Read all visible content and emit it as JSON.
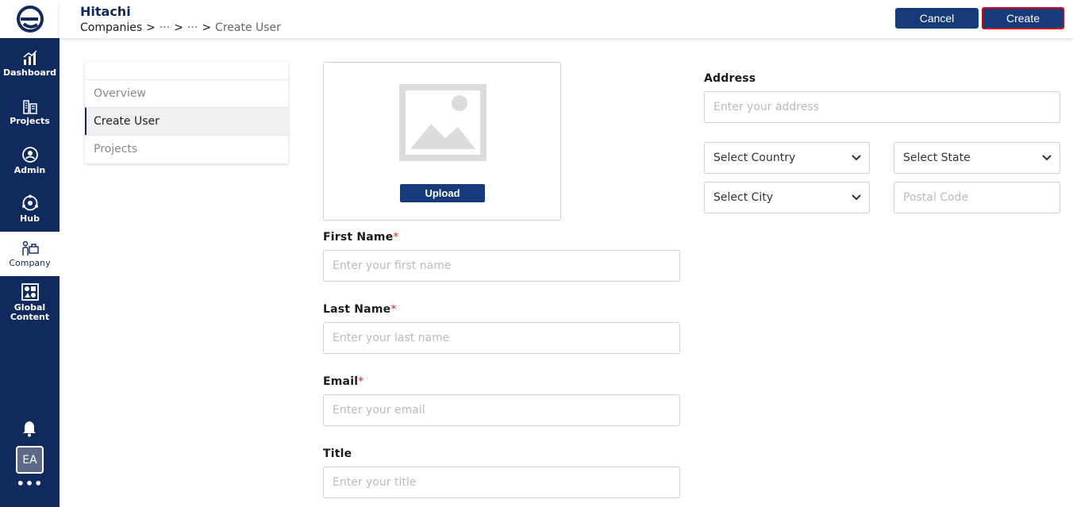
{
  "sidebar": {
    "items": [
      {
        "label": "Dashboard",
        "icon": "dashboard-icon"
      },
      {
        "label": "Projects",
        "icon": "projects-icon"
      },
      {
        "label": "Admin",
        "icon": "admin-icon"
      },
      {
        "label": "Hub",
        "icon": "hub-icon"
      },
      {
        "label": "Company",
        "icon": "company-icon",
        "active": true
      },
      {
        "label": "Global Content",
        "icon": "global-content-icon"
      }
    ],
    "avatar_initials": "EA",
    "more": "•••"
  },
  "header": {
    "title": "Hitachi",
    "breadcrumb": {
      "first": "Companies",
      "sep": ">",
      "ellipsis1": "···",
      "ellipsis2": "···",
      "current": "Create User"
    },
    "cancel_label": "Cancel",
    "create_label": "Create"
  },
  "tabs": [
    {
      "label": "Overview"
    },
    {
      "label": "Create User",
      "active": true
    },
    {
      "label": "Projects"
    }
  ],
  "upload": {
    "button_label": "Upload"
  },
  "form": {
    "first_name": {
      "label": "First Name",
      "required": "*",
      "placeholder": "Enter your first name"
    },
    "last_name": {
      "label": "Last Name",
      "required": "*",
      "placeholder": "Enter your last name"
    },
    "email": {
      "label": "Email",
      "required": "*",
      "placeholder": "Enter your email"
    },
    "title": {
      "label": "Title",
      "placeholder": "Enter your title"
    },
    "address": {
      "label": "Address",
      "placeholder": "Enter your address"
    },
    "country": {
      "value": "Select Country"
    },
    "state": {
      "value": "Select State"
    },
    "city": {
      "value": "Select City"
    },
    "postal": {
      "placeholder": "Postal Code"
    }
  },
  "colors": {
    "primary": "#112a5e",
    "button": "#173a7a",
    "highlight": "#d0021b",
    "required": "#c2272d"
  }
}
